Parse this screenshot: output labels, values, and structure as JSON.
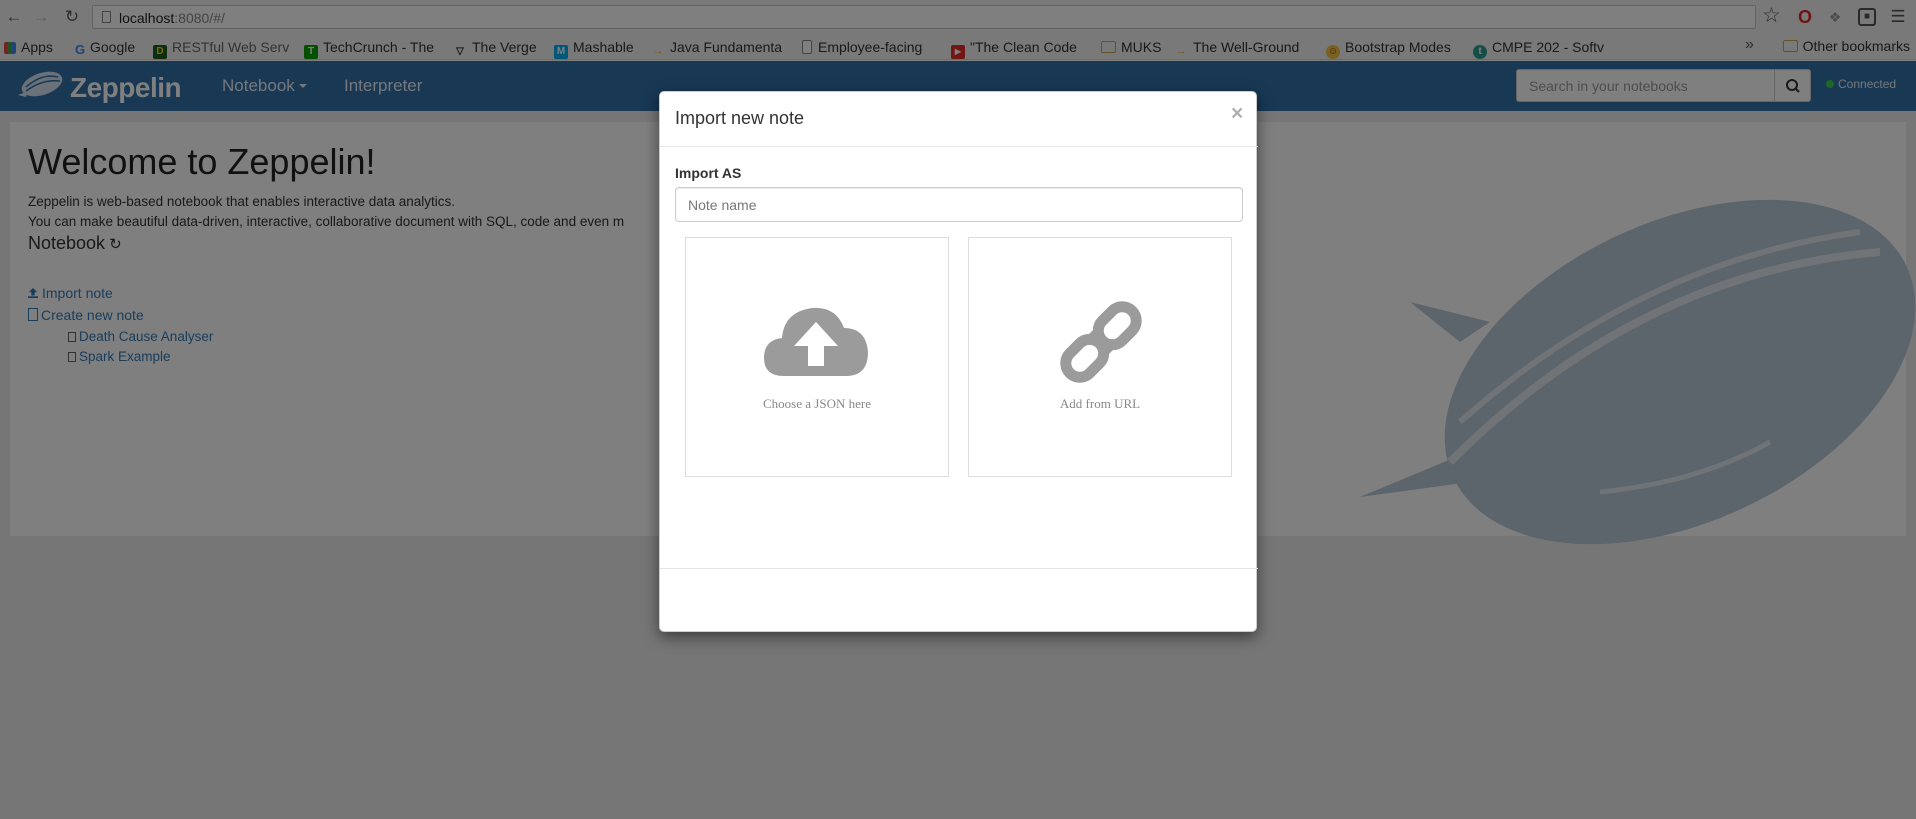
{
  "browser": {
    "url_host": "localhost",
    "url_rest": ":8080/#/",
    "bookmarks": [
      {
        "label": "Apps",
        "icon": "apps-grid-icon"
      },
      {
        "label": "Google",
        "icon": "google-icon"
      },
      {
        "label": "RESTful Web Serv",
        "icon": "d-icon"
      },
      {
        "label": "TechCrunch - The",
        "icon": "techcrunch-icon"
      },
      {
        "label": "The Verge",
        "icon": "verge-icon"
      },
      {
        "label": "Mashable",
        "icon": "mashable-icon"
      },
      {
        "label": "Java Fundamenta",
        "icon": "arrow-icon"
      },
      {
        "label": "Employee-facing",
        "icon": "page-icon"
      },
      {
        "label": "\"The Clean Code",
        "icon": "youtube-icon"
      },
      {
        "label": "MUKS",
        "icon": "folder-icon"
      },
      {
        "label": "The Well-Ground",
        "icon": "arrow-icon"
      },
      {
        "label": "Bootstrap Modes",
        "icon": "smiley-icon"
      },
      {
        "label": "CMPE 202 - Softv",
        "icon": "t-icon"
      }
    ],
    "overflow": "»",
    "other_bookmarks": "Other bookmarks"
  },
  "navbar": {
    "brand": "Zeppelin",
    "notebook": "Notebook",
    "interpreter": "Interpreter",
    "search_placeholder": "Search in your notebooks",
    "status": "Connected",
    "status_color": "#3ccf4e"
  },
  "main": {
    "title": "Welcome to Zeppelin!",
    "intro_line1": "Zeppelin is web-based notebook that enables interactive data analytics.",
    "intro_line2": "You can make beautiful data-driven, interactive, collaborative document with SQL, code and even m",
    "notebook_heading": "Notebook",
    "import_note": "Import note",
    "create_note": "Create new note",
    "notes": [
      "Death Cause Analyser",
      "Spark Example"
    ]
  },
  "modal": {
    "title": "Import new note",
    "close": "×",
    "import_as_label": "Import AS",
    "note_name_placeholder": "Note name",
    "choose_json": "Choose a JSON here",
    "add_from_url": "Add from URL"
  },
  "colors": {
    "navbar": "#3071a9",
    "link": "#337ab7"
  }
}
